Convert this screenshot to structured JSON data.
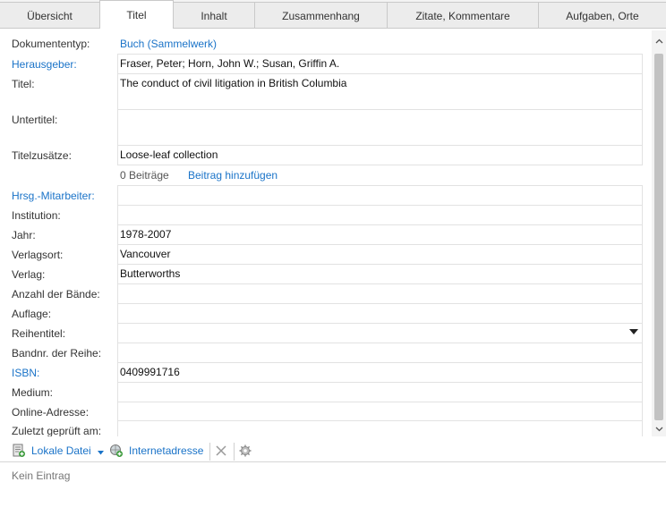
{
  "tabs": [
    {
      "label": "Übersicht"
    },
    {
      "label": "Titel"
    },
    {
      "label": "Inhalt"
    },
    {
      "label": "Zusammenhang"
    },
    {
      "label": "Zitate, Kommentare"
    },
    {
      "label": "Aufgaben, Orte"
    }
  ],
  "active_tab": "Titel",
  "form": {
    "doctype_label": "Dokumententyp:",
    "doctype_value": "Buch (Sammelwerk)",
    "editors_label": "Herausgeber:",
    "editors_value": "Fraser, Peter; Horn, John W.; Susan, Griffin A.",
    "title_label": "Titel:",
    "title_value": "The conduct of civil litigation in British Columbia",
    "subtitle_label": "Untertitel:",
    "subtitle_value": "",
    "title_suffix_label": "Titelzusätze:",
    "title_suffix_value": "Loose-leaf collection",
    "contributions_count": "0 Beiträge",
    "contributions_add": "Beitrag hinzufügen",
    "co_editors_label": "Hrsg.-Mitarbeiter:",
    "co_editors_value": "",
    "institution_label": "Institution:",
    "institution_value": "",
    "year_label": "Jahr:",
    "year_value": "1978-2007",
    "place_label": "Verlagsort:",
    "place_value": "Vancouver",
    "publisher_label": "Verlag:",
    "publisher_value": "Butterworths",
    "volumes_label": "Anzahl der Bände:",
    "volumes_value": "",
    "edition_label": "Auflage:",
    "edition_value": "",
    "series_label": "Reihentitel:",
    "series_value": "",
    "series_no_label": "Bandnr. der Reihe:",
    "series_no_value": "",
    "isbn_label": "ISBN:",
    "isbn_value": "0409991716",
    "medium_label": "Medium:",
    "medium_value": "",
    "online_label": "Online-Adresse:",
    "online_value": "",
    "checked_label": "Zuletzt geprüft am:",
    "checked_value": ""
  },
  "toolbar": {
    "local_file": "Lokale Datei",
    "internet_address": "Internetadresse"
  },
  "notes": {
    "empty_text": "Kein Eintrag"
  },
  "colors": {
    "link": "#1a73c8",
    "tab_bg": "#ececec",
    "border": "#c9c9c9"
  }
}
